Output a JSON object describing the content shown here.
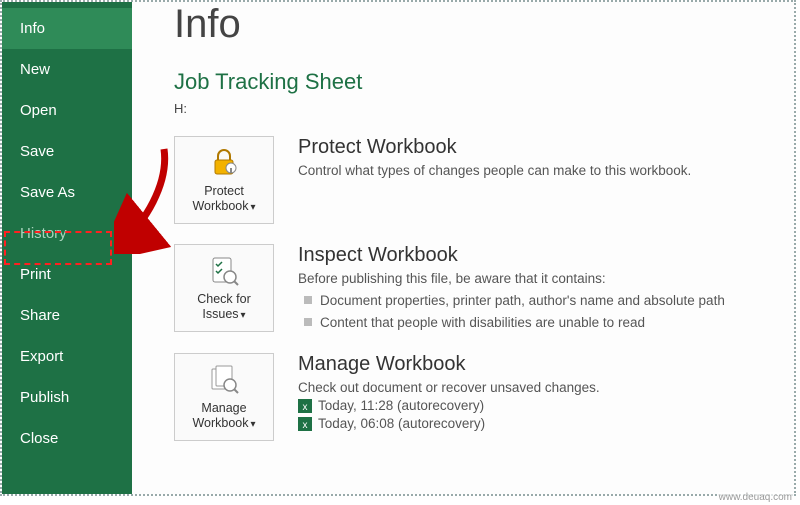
{
  "sidebar": {
    "items": [
      {
        "label": "Info",
        "selected": true
      },
      {
        "label": "New",
        "selected": false
      },
      {
        "label": "Open",
        "selected": false
      },
      {
        "label": "Save",
        "selected": false
      },
      {
        "label": "Save As",
        "selected": false
      },
      {
        "label": "History",
        "selected": false
      },
      {
        "label": "Print",
        "selected": false
      },
      {
        "label": "Share",
        "selected": false
      },
      {
        "label": "Export",
        "selected": false
      },
      {
        "label": "Publish",
        "selected": false
      },
      {
        "label": "Close",
        "selected": false
      }
    ]
  },
  "page": {
    "title": "Info",
    "doc_title": "Job Tracking Sheet",
    "doc_path": "H:"
  },
  "protect": {
    "tile_label": "Protect Workbook",
    "title": "Protect Workbook",
    "desc": "Control what types of changes people can make to this workbook."
  },
  "inspect": {
    "tile_label": "Check for Issues",
    "title": "Inspect Workbook",
    "desc": "Before publishing this file, be aware that it contains:",
    "items": [
      "Document properties, printer path, author's name and absolute path",
      "Content that people with disabilities are unable to read"
    ]
  },
  "manage": {
    "tile_label": "Manage Workbook",
    "title": "Manage Workbook",
    "desc": "Check out document or recover unsaved changes.",
    "versions": [
      "Today, 11:28 (autorecovery)",
      "Today, 06:08 (autorecovery)"
    ]
  },
  "watermark": "www.deuaq.com"
}
